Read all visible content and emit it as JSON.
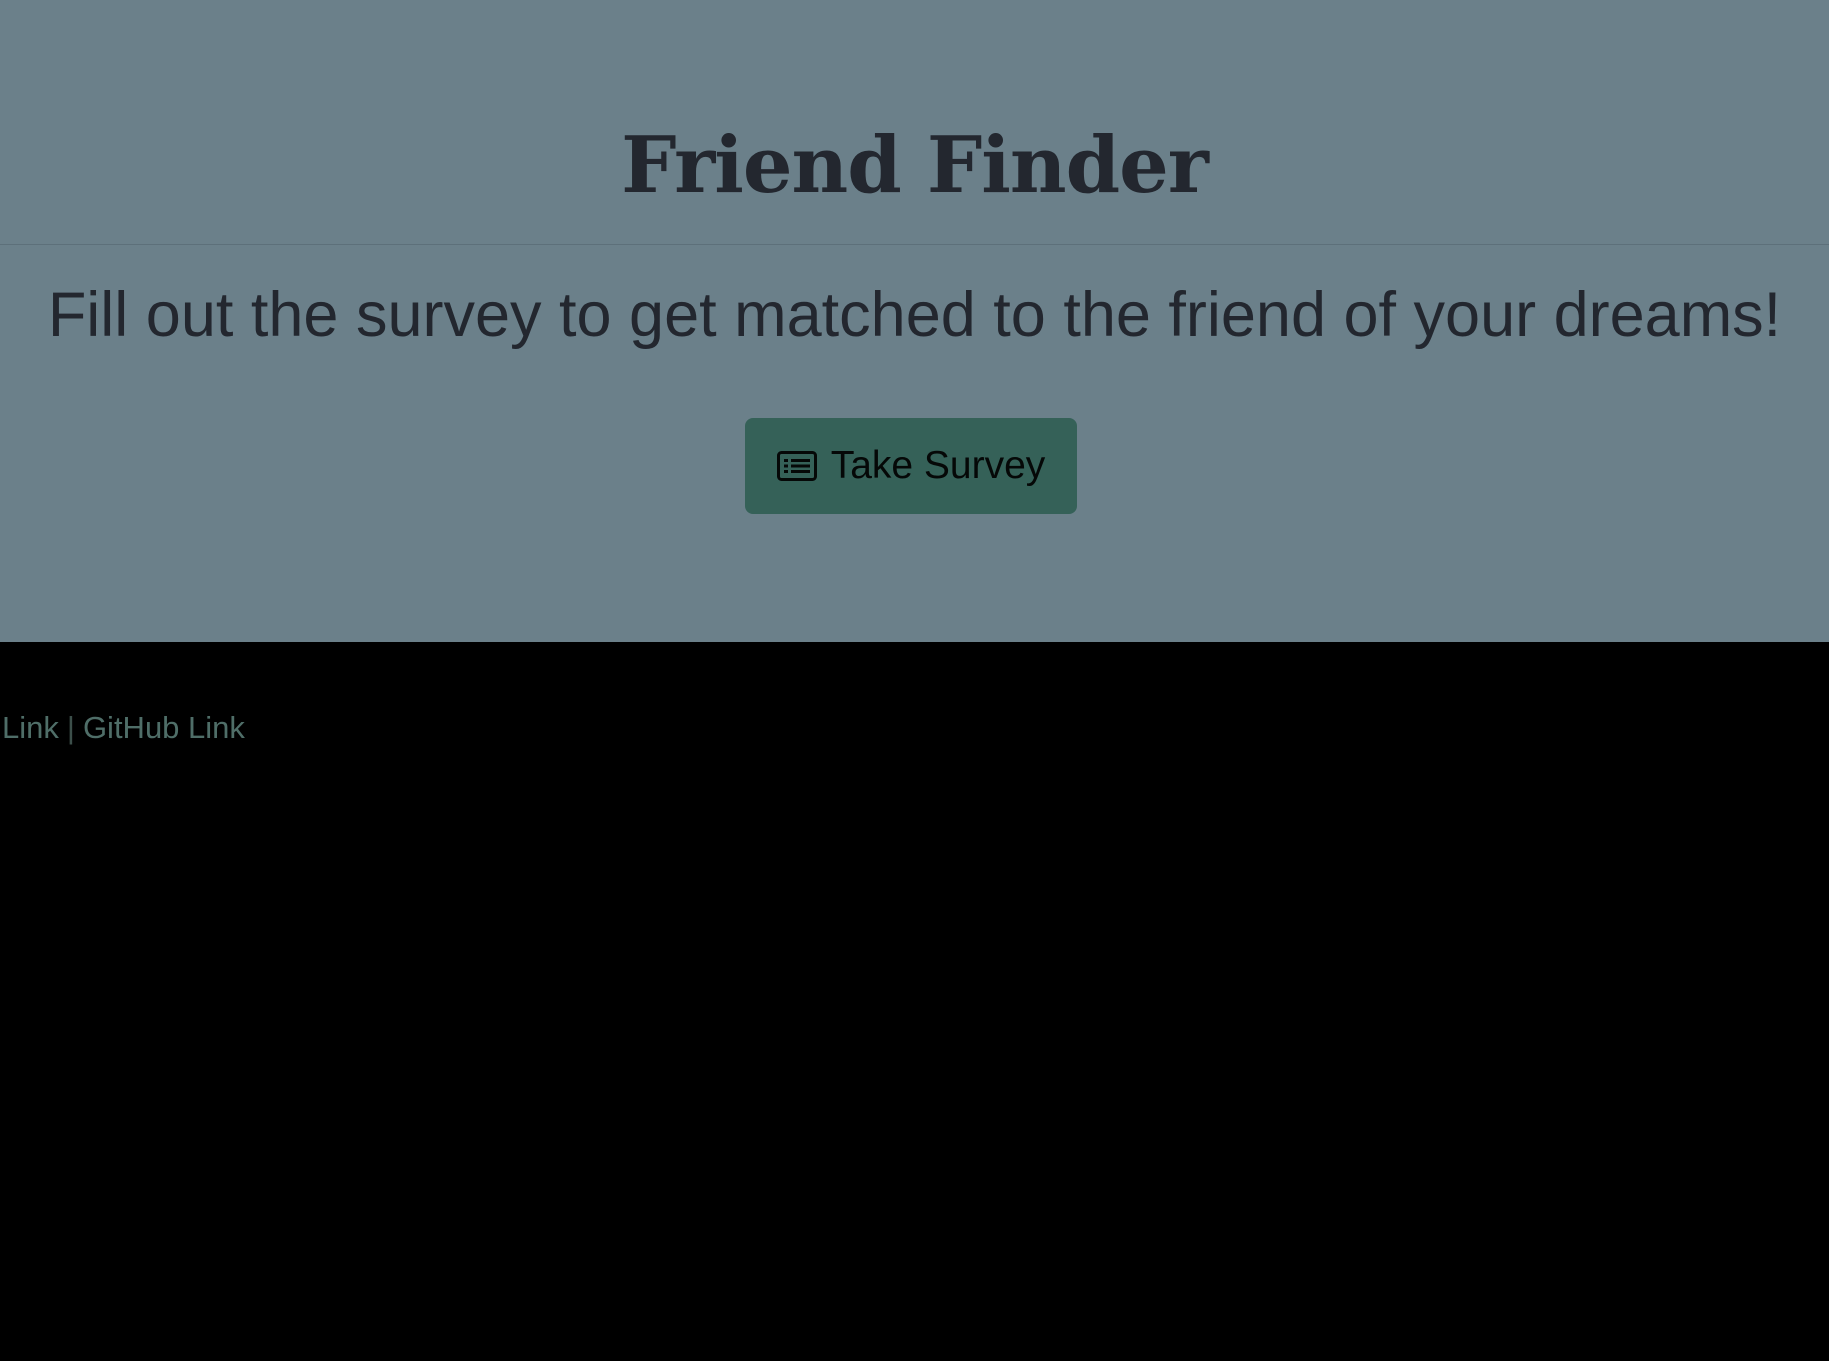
{
  "header": {
    "title": "Friend Finder",
    "tagline": "Fill out the survey to get matched to the friend of your dreams!"
  },
  "survey_button": {
    "icon": "list-alt-icon",
    "label": "Take Survey"
  },
  "footer": {
    "links": [
      {
        "label": "Link"
      },
      {
        "label": "GitHub Link"
      }
    ],
    "separator": "|"
  },
  "colors": {
    "jumbotron_bg": "#6b808a",
    "page_bg": "#000000",
    "button_bg": "#356158",
    "text_dark": "#23272f",
    "link": "#4f6e68"
  }
}
